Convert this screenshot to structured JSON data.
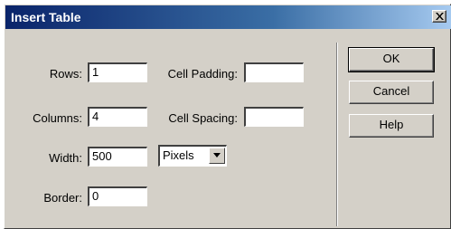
{
  "window": {
    "title": "Insert Table",
    "close_icon": "close-icon"
  },
  "form": {
    "rows": {
      "label": "Rows:",
      "value": "1"
    },
    "columns": {
      "label": "Columns:",
      "value": "4"
    },
    "width": {
      "label": "Width:",
      "value": "500"
    },
    "width_unit": {
      "selected": "Pixels",
      "arrow_icon": "dropdown-arrow-icon"
    },
    "border": {
      "label": "Border:",
      "value": "0"
    },
    "cell_padding": {
      "label": "Cell Padding:",
      "value": ""
    },
    "cell_spacing": {
      "label": "Cell Spacing:",
      "value": ""
    }
  },
  "buttons": {
    "ok": "OK",
    "cancel": "Cancel",
    "help": "Help"
  },
  "colors": {
    "title_bar_start": "#0a246a",
    "title_bar_end": "#a6caf0",
    "dialog_face": "#d4d0c8"
  }
}
